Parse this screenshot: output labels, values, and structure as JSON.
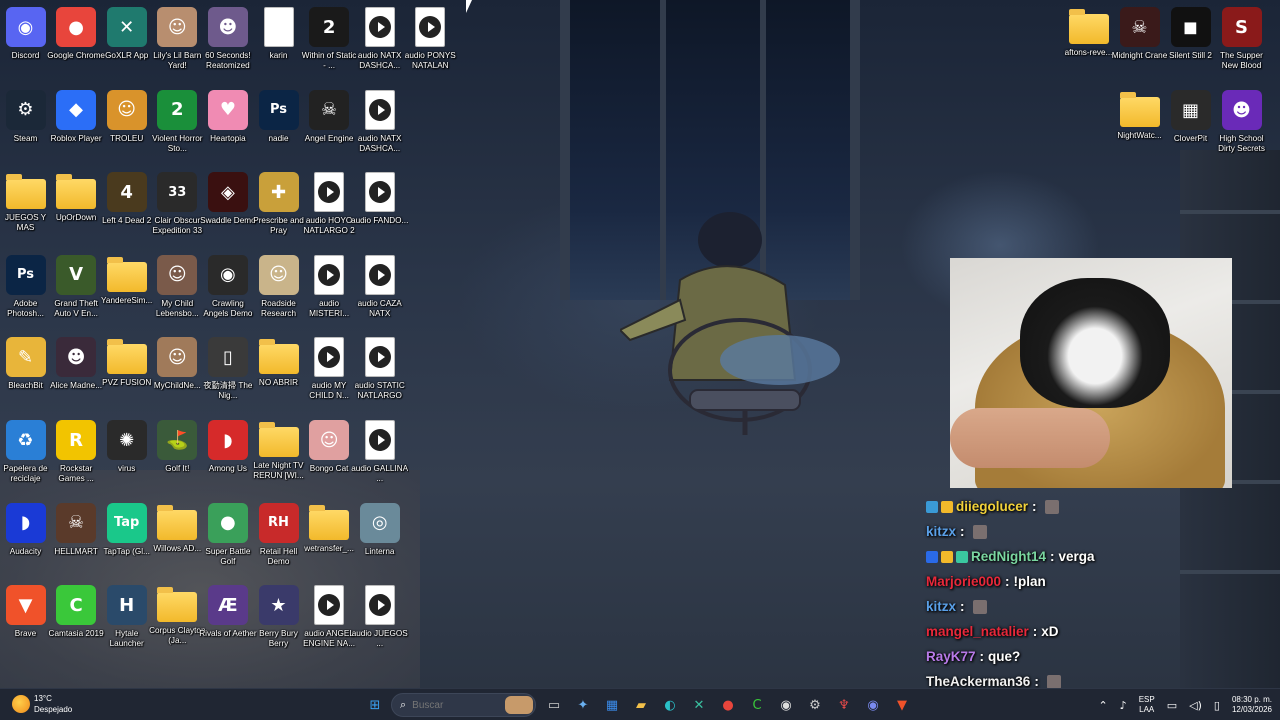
{
  "desktop": {
    "icons": [
      {
        "label": "Discord",
        "kind": "app",
        "color": "#5865f2",
        "glyph": "◉",
        "col": 0,
        "row": 0
      },
      {
        "label": "Google Chrome",
        "kind": "app",
        "color": "#e8453c",
        "glyph": "●",
        "col": 1,
        "row": 0
      },
      {
        "label": "GoXLR App",
        "kind": "app",
        "color": "#1f7a6e",
        "glyph": "✕",
        "col": 2,
        "row": 0
      },
      {
        "label": "Lily's Lil Barn Yard!",
        "kind": "app",
        "color": "#b88e6f",
        "glyph": "☺",
        "col": 3,
        "row": 0
      },
      {
        "label": "60 Seconds! Reatomized",
        "kind": "app",
        "color": "#6e5a8c",
        "glyph": "☻",
        "col": 4,
        "row": 0
      },
      {
        "label": "karin",
        "kind": "doc",
        "color": "#ffffff",
        "glyph": "",
        "col": 5,
        "row": 0
      },
      {
        "label": "Within of Static - ...",
        "kind": "app",
        "color": "#1a1a1a",
        "glyph": "2",
        "col": 6,
        "row": 0
      },
      {
        "label": "audio NATX DASHCA...",
        "kind": "media",
        "color": "#ffffff",
        "glyph": "",
        "col": 7,
        "row": 0
      },
      {
        "label": "audio PONYS NATALAN",
        "kind": "media",
        "color": "#ffffff",
        "glyph": "",
        "col": 8,
        "row": 0
      },
      {
        "label": "Steam",
        "kind": "app",
        "color": "#1b2838",
        "glyph": "⚙",
        "col": 0,
        "row": 1
      },
      {
        "label": "Roblox Player",
        "kind": "app",
        "color": "#2b6ef7",
        "glyph": "◆",
        "col": 1,
        "row": 1
      },
      {
        "label": "TROLEU",
        "kind": "app",
        "color": "#d9932b",
        "glyph": "☺",
        "col": 2,
        "row": 1
      },
      {
        "label": "Violent Horror Sto...",
        "kind": "app",
        "color": "#1a8f3a",
        "glyph": "2",
        "col": 3,
        "row": 1
      },
      {
        "label": "Heartopia",
        "kind": "app",
        "color": "#f08bb3",
        "glyph": "♥",
        "col": 4,
        "row": 1
      },
      {
        "label": "nadie",
        "kind": "app",
        "color": "#0b2545",
        "glyph": "Ps",
        "col": 5,
        "row": 1
      },
      {
        "label": "Angel Engine",
        "kind": "app",
        "color": "#222222",
        "glyph": "☠",
        "col": 6,
        "row": 1
      },
      {
        "label": "audio NATX DASHCA...",
        "kind": "media",
        "color": "#ffffff",
        "glyph": "",
        "col": 7,
        "row": 1
      },
      {
        "label": "JUEGOS Y MAS",
        "kind": "folder",
        "color": "#f2b92b",
        "glyph": "",
        "col": 0,
        "row": 2
      },
      {
        "label": "UpOrDown",
        "kind": "folder",
        "color": "#f2b92b",
        "glyph": "",
        "col": 1,
        "row": 2
      },
      {
        "label": "Left 4 Dead 2",
        "kind": "app",
        "color": "#4a3a1e",
        "glyph": "4",
        "col": 2,
        "row": 2
      },
      {
        "label": "Clair Obscur Expedition 33",
        "kind": "app",
        "color": "#2a2a2a",
        "glyph": "33",
        "col": 3,
        "row": 2
      },
      {
        "label": "Swaddle Demo",
        "kind": "app",
        "color": "#3a1010",
        "glyph": "◈",
        "col": 4,
        "row": 2
      },
      {
        "label": "Prescribe and Pray",
        "kind": "app",
        "color": "#c9a03a",
        "glyph": "✚",
        "col": 5,
        "row": 2
      },
      {
        "label": "audio HOYO NATLARGO 2",
        "kind": "media",
        "color": "#ffffff",
        "glyph": "",
        "col": 6,
        "row": 2
      },
      {
        "label": "audio FANDO...",
        "kind": "media",
        "color": "#ffffff",
        "glyph": "",
        "col": 7,
        "row": 2
      },
      {
        "label": "Adobe Photosh...",
        "kind": "app",
        "color": "#0b2545",
        "glyph": "Ps",
        "col": 0,
        "row": 3
      },
      {
        "label": "Grand Theft Auto V En...",
        "kind": "app",
        "color": "#3a5a2a",
        "glyph": "V",
        "col": 1,
        "row": 3
      },
      {
        "label": "YandereSim...",
        "kind": "folder",
        "color": "#f2b92b",
        "glyph": "",
        "col": 2,
        "row": 3
      },
      {
        "label": "My Child Lebensbo...",
        "kind": "app",
        "color": "#7a5a4a",
        "glyph": "☺",
        "col": 3,
        "row": 3
      },
      {
        "label": "Crawling Angels Demo",
        "kind": "app",
        "color": "#2a2a2a",
        "glyph": "◉",
        "col": 4,
        "row": 3
      },
      {
        "label": "Roadside Research",
        "kind": "app",
        "color": "#c9b48a",
        "glyph": "☺",
        "col": 5,
        "row": 3
      },
      {
        "label": "audio MISTERI...",
        "kind": "media",
        "color": "#ffffff",
        "glyph": "",
        "col": 6,
        "row": 3
      },
      {
        "label": "audio CAZA NATX",
        "kind": "media",
        "color": "#ffffff",
        "glyph": "",
        "col": 7,
        "row": 3
      },
      {
        "label": "BleachBit",
        "kind": "app",
        "color": "#e8b53a",
        "glyph": "✎",
        "col": 0,
        "row": 4
      },
      {
        "label": "Alice Madne...",
        "kind": "app",
        "color": "#3a2a3a",
        "glyph": "☻",
        "col": 1,
        "row": 4
      },
      {
        "label": "PVZ FUSION",
        "kind": "folder",
        "color": "#f2b92b",
        "glyph": "",
        "col": 2,
        "row": 4
      },
      {
        "label": "MyChildNe...",
        "kind": "app",
        "color": "#a07a5a",
        "glyph": "☺",
        "col": 3,
        "row": 4
      },
      {
        "label": "夜勤清掃 The Nig...",
        "kind": "app",
        "color": "#3a3a3a",
        "glyph": "▯",
        "col": 4,
        "row": 4
      },
      {
        "label": "NO ABRIR",
        "kind": "folder",
        "color": "#f2b92b",
        "glyph": "",
        "col": 5,
        "row": 4
      },
      {
        "label": "audio MY CHILD N...",
        "kind": "media",
        "color": "#ffffff",
        "glyph": "",
        "col": 6,
        "row": 4
      },
      {
        "label": "audio STATIC NATLARGO",
        "kind": "media",
        "color": "#ffffff",
        "glyph": "",
        "col": 7,
        "row": 4
      },
      {
        "label": "Papelera de reciclaje",
        "kind": "app",
        "color": "#2a7fd6",
        "glyph": "♻",
        "col": 0,
        "row": 5
      },
      {
        "label": "Rockstar Games ...",
        "kind": "app",
        "color": "#f2c400",
        "glyph": "R",
        "col": 1,
        "row": 5
      },
      {
        "label": "virus",
        "kind": "app",
        "color": "#2a2a2a",
        "glyph": "✺",
        "col": 2,
        "row": 5
      },
      {
        "label": "Golf It!",
        "kind": "app",
        "color": "#3a5a3a",
        "glyph": "⛳",
        "col": 3,
        "row": 5
      },
      {
        "label": "Among Us",
        "kind": "app",
        "color": "#d62a2a",
        "glyph": "◗",
        "col": 4,
        "row": 5
      },
      {
        "label": "Late Night TV RERUN [WI...",
        "kind": "folder",
        "color": "#f2b92b",
        "glyph": "",
        "col": 5,
        "row": 5
      },
      {
        "label": "Bongo Cat",
        "kind": "app",
        "color": "#e0a0a0",
        "glyph": "☺",
        "col": 6,
        "row": 5
      },
      {
        "label": "audio GALLINA ...",
        "kind": "media",
        "color": "#ffffff",
        "glyph": "",
        "col": 7,
        "row": 5
      },
      {
        "label": "Audacity",
        "kind": "app",
        "color": "#1a3ad6",
        "glyph": "◗",
        "col": 0,
        "row": 6
      },
      {
        "label": "HELLMART",
        "kind": "app",
        "color": "#5a3a2a",
        "glyph": "☠",
        "col": 1,
        "row": 6
      },
      {
        "label": "TapTap (Gl...",
        "kind": "app",
        "color": "#1ac88a",
        "glyph": "Tap",
        "col": 2,
        "row": 6
      },
      {
        "label": "Willows AD...",
        "kind": "folder",
        "color": "#f2b92b",
        "glyph": "",
        "col": 3,
        "row": 6
      },
      {
        "label": "Super Battle Golf",
        "kind": "app",
        "color": "#3aa05a",
        "glyph": "●",
        "col": 4,
        "row": 6
      },
      {
        "label": "Retail Hell Demo",
        "kind": "app",
        "color": "#c82a2a",
        "glyph": "RH",
        "col": 5,
        "row": 6
      },
      {
        "label": "wetransfer_...",
        "kind": "folder",
        "color": "#f2b92b",
        "glyph": "",
        "col": 6,
        "row": 6
      },
      {
        "label": "Linterna",
        "kind": "app",
        "color": "#6a8a9a",
        "glyph": "◎",
        "col": 7,
        "row": 6
      },
      {
        "label": "Brave",
        "kind": "app",
        "color": "#f0522a",
        "glyph": "▼",
        "col": 0,
        "row": 7
      },
      {
        "label": "Camtasia 2019",
        "kind": "app",
        "color": "#3ac83a",
        "glyph": "C",
        "col": 1,
        "row": 7
      },
      {
        "label": "Hytale Launcher",
        "kind": "app",
        "color": "#2a4a6a",
        "glyph": "H",
        "col": 2,
        "row": 7
      },
      {
        "label": "Corpus Clayton (Ja...",
        "kind": "folder",
        "color": "#f2b92b",
        "glyph": "",
        "col": 3,
        "row": 7
      },
      {
        "label": "Rivals of Aether",
        "kind": "app",
        "color": "#5a3a8a",
        "glyph": "Æ",
        "col": 4,
        "row": 7
      },
      {
        "label": "Berry Bury Berry",
        "kind": "app",
        "color": "#3a3a6a",
        "glyph": "★",
        "col": 5,
        "row": 7
      },
      {
        "label": "audio ANGEL ENGINE NA...",
        "kind": "media",
        "color": "#ffffff",
        "glyph": "",
        "col": 6,
        "row": 7
      },
      {
        "label": "audio JUEGOS ...",
        "kind": "media",
        "color": "#ffffff",
        "glyph": "",
        "col": 7,
        "row": 7
      }
    ],
    "right_icons": [
      {
        "label": "aftons-reve...",
        "kind": "folder",
        "color": "#f2b92b",
        "glyph": ""
      },
      {
        "label": "Midnight Crane",
        "kind": "app",
        "color": "#3a1a1a",
        "glyph": "☠"
      },
      {
        "label": "Silent Still 2",
        "kind": "app",
        "color": "#111111",
        "glyph": "◼"
      },
      {
        "label": "The Supper New Blood",
        "kind": "app",
        "color": "#8a1a1a",
        "glyph": "S"
      },
      {
        "label": "NightWatc...",
        "kind": "folder",
        "color": "#f2b92b",
        "glyph": ""
      },
      {
        "label": "CloverPit",
        "kind": "app",
        "color": "#2a2a2a",
        "glyph": "▦"
      },
      {
        "label": "High School Dirty Secrets",
        "kind": "app",
        "color": "#6a2ab8",
        "glyph": "☻"
      }
    ]
  },
  "chat": [
    {
      "user": "diiegolucer",
      "color": "#f2d23a",
      "message": "",
      "emote": true,
      "badges": [
        "#3a9ad6",
        "#f2b92b"
      ]
    },
    {
      "user": "kitzx",
      "color": "#5aa0e8",
      "message": "",
      "emote": true,
      "badges": []
    },
    {
      "user": "RedNight14",
      "color": "#7ad6a0",
      "message": "verga",
      "emote": false,
      "badges": [
        "#2a6ae8",
        "#f2b92b",
        "#3ac8a0"
      ]
    },
    {
      "user": "Marjorie000",
      "color": "#e8283a",
      "message": "!plan",
      "emote": false,
      "badges": []
    },
    {
      "user": "kitzx",
      "color": "#5aa0e8",
      "message": "",
      "emote": true,
      "badges": []
    },
    {
      "user": "mangel_natalier",
      "color": "#e8283a",
      "message": "xD",
      "emote": false,
      "badges": []
    },
    {
      "user": "RayK77",
      "color": "#b87ae8",
      "message": "que?",
      "emote": false,
      "badges": []
    },
    {
      "user": "TheAckerman36",
      "color": "#f0f0f0",
      "message": "",
      "emote": true,
      "badges": []
    }
  ],
  "taskbar": {
    "weather_temp": "13°C",
    "weather_desc": "Despejado",
    "search_placeholder": "Buscar",
    "apps": [
      {
        "name": "start-button",
        "glyph": "⊞",
        "color": "#3aa0f0"
      },
      {
        "name": "task-view",
        "glyph": "▭",
        "color": "#cccccc"
      },
      {
        "name": "copilot",
        "glyph": "✦",
        "color": "#6ab0f0"
      },
      {
        "name": "store",
        "glyph": "▦",
        "color": "#3a8ae8"
      },
      {
        "name": "file-explorer",
        "glyph": "▰",
        "color": "#f2c04a"
      },
      {
        "name": "edge",
        "glyph": "◐",
        "color": "#2ac0c8"
      },
      {
        "name": "goxlr",
        "glyph": "✕",
        "color": "#3ac0a0"
      },
      {
        "name": "chrome",
        "glyph": "●",
        "color": "#e8453c"
      },
      {
        "name": "camtasia",
        "glyph": "C",
        "color": "#3ac83a"
      },
      {
        "name": "obs",
        "glyph": "◉",
        "color": "#dddddd"
      },
      {
        "name": "steam",
        "glyph": "⚙",
        "color": "#cccccc"
      },
      {
        "name": "app-red",
        "glyph": "♆",
        "color": "#e84a4a"
      },
      {
        "name": "discord",
        "glyph": "◉",
        "color": "#7a8af0"
      },
      {
        "name": "brave",
        "glyph": "▼",
        "color": "#f0522a"
      }
    ],
    "lang_line1": "ESP",
    "lang_line2": "LAA",
    "time": "08:30 p. m.",
    "date": "12/03/2026"
  }
}
